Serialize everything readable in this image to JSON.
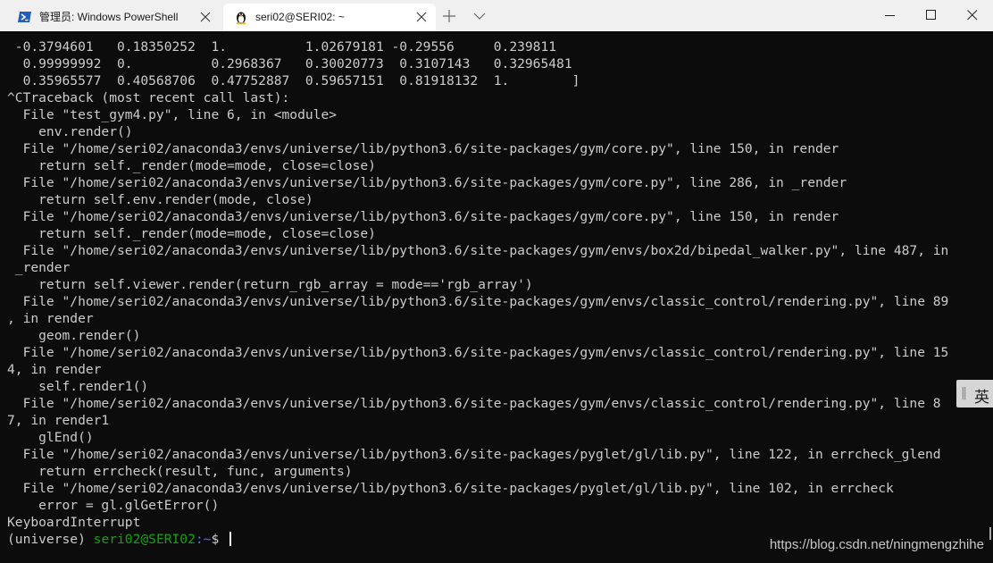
{
  "tabs": [
    {
      "title": "管理员: Windows PowerShell",
      "icon": "powershell-icon",
      "active": false
    },
    {
      "title": "seri02@SERI02: ~",
      "icon": "linux-penguin-icon",
      "active": true
    }
  ],
  "tabbar": {
    "new_tab_icon": "plus-icon",
    "dropdown_icon": "chevron-down-icon"
  },
  "window_controls": [
    "minimize-icon",
    "maximize-icon",
    "close-icon"
  ],
  "terminal": {
    "lines": [
      " -0.3794601   0.18350252  1.          1.02679181 -0.29556     0.239811",
      "  0.99999992  0.          0.2968367   0.30020773  0.3107143   0.32965481",
      "  0.35965577  0.40568706  0.47752887  0.59657151  0.81918132  1.        ]",
      "^CTraceback (most recent call last):",
      "  File \"test_gym4.py\", line 6, in <module>",
      "    env.render()",
      "  File \"/home/seri02/anaconda3/envs/universe/lib/python3.6/site-packages/gym/core.py\", line 150, in render",
      "    return self._render(mode=mode, close=close)",
      "  File \"/home/seri02/anaconda3/envs/universe/lib/python3.6/site-packages/gym/core.py\", line 286, in _render",
      "    return self.env.render(mode, close)",
      "  File \"/home/seri02/anaconda3/envs/universe/lib/python3.6/site-packages/gym/core.py\", line 150, in render",
      "    return self._render(mode=mode, close=close)",
      "  File \"/home/seri02/anaconda3/envs/universe/lib/python3.6/site-packages/gym/envs/box2d/bipedal_walker.py\", line 487, in",
      " _render",
      "    return self.viewer.render(return_rgb_array = mode=='rgb_array')",
      "  File \"/home/seri02/anaconda3/envs/universe/lib/python3.6/site-packages/gym/envs/classic_control/rendering.py\", line 89",
      ", in render",
      "    geom.render()",
      "  File \"/home/seri02/anaconda3/envs/universe/lib/python3.6/site-packages/gym/envs/classic_control/rendering.py\", line 15",
      "4, in render",
      "    self.render1()",
      "  File \"/home/seri02/anaconda3/envs/universe/lib/python3.6/site-packages/gym/envs/classic_control/rendering.py\", line 8",
      "7, in render1",
      "    glEnd()",
      "  File \"/home/seri02/anaconda3/envs/universe/lib/python3.6/site-packages/pyglet/gl/lib.py\", line 122, in errcheck_glend",
      "    return errcheck(result, func, arguments)",
      "  File \"/home/seri02/anaconda3/envs/universe/lib/python3.6/site-packages/pyglet/gl/lib.py\", line 102, in errcheck",
      "    error = gl.glGetError()",
      "KeyboardInterrupt"
    ],
    "prompt": {
      "env": "(universe) ",
      "user_host": "seri02@SERI02",
      "path": ":~",
      "symbol": "$ "
    }
  },
  "ime": {
    "grip": "‖",
    "language": "英"
  },
  "watermark": "https://blog.csdn.net/ningmengzhihe",
  "colors": {
    "terminal_bg": "#0c0c0c",
    "terminal_fg": "#cccccc",
    "prompt_user": "#13a10e",
    "prompt_path": "#3b78ff",
    "tabbar_bg": "#f0f0f0",
    "active_tab_bg": "#ffffff"
  }
}
